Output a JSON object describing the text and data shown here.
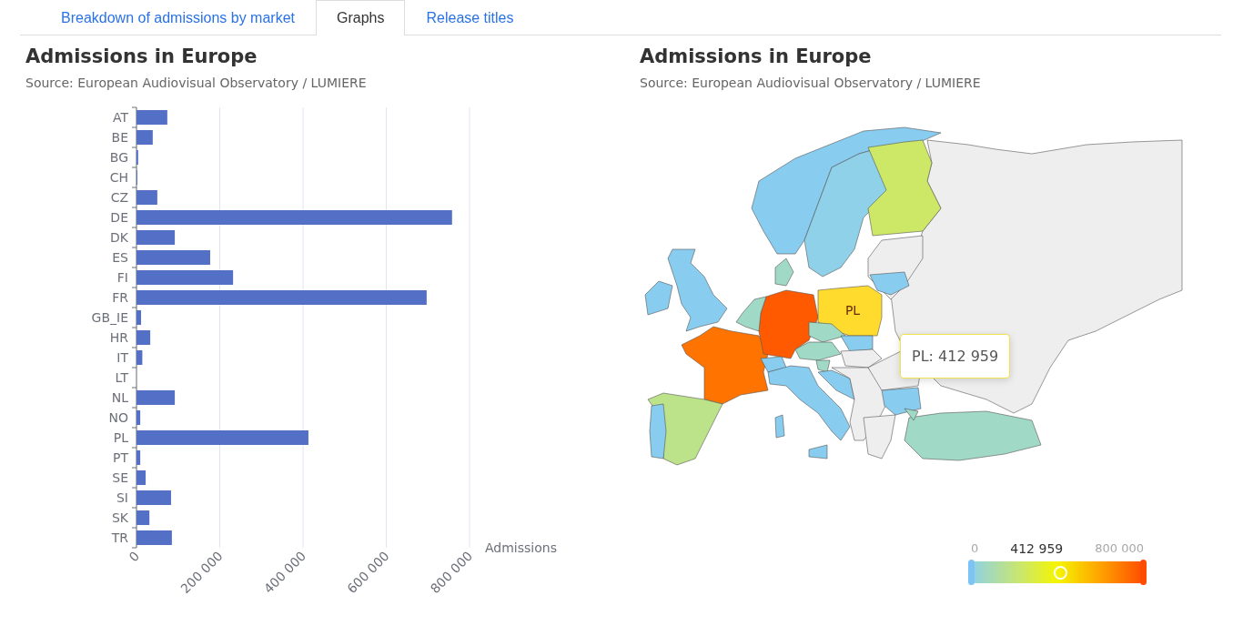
{
  "tabs": [
    {
      "label": "Breakdown of admissions by market",
      "selected": false
    },
    {
      "label": "Graphs",
      "selected": true
    },
    {
      "label": "Release titles",
      "selected": false
    }
  ],
  "bar_panel": {
    "title": "Admissions in Europe",
    "source": "Source: European Audiovisual Observatory / LUMIERE",
    "chart_data": {
      "type": "bar",
      "orientation": "horizontal",
      "xlabel": "Admissions",
      "categories": [
        "AT",
        "BE",
        "BG",
        "CH",
        "CZ",
        "DE",
        "DK",
        "ES",
        "FI",
        "FR",
        "GB_IE",
        "HR",
        "IT",
        "LT",
        "NL",
        "NO",
        "PL",
        "PT",
        "SE",
        "SI",
        "SK",
        "TR"
      ],
      "grid": true,
      "series": [
        {
          "color": "#5470c6",
          "values": [
            74000,
            39000,
            4000,
            2000,
            50000,
            758000,
            92000,
            177000,
            232000,
            697000,
            11000,
            33000,
            14000,
            0,
            92000,
            9000,
            413000,
            9000,
            22000,
            83000,
            31000,
            85000
          ]
        }
      ],
      "xlim": [
        0,
        800000
      ],
      "xticks": [
        {
          "value": 0,
          "label": "0"
        },
        {
          "value": 200000,
          "label": "200 000"
        },
        {
          "value": 400000,
          "label": "400 000"
        },
        {
          "value": 600000,
          "label": "600 000"
        },
        {
          "value": 800000,
          "label": "800 000"
        }
      ]
    }
  },
  "map_panel": {
    "title": "Admissions in Europe",
    "source": "Source: European Audiovisual Observatory / LUMIERE",
    "map_label": "PL",
    "tooltip": "PL: 412 959",
    "legend": {
      "min": "0",
      "max": "800 000",
      "reading": "412 959",
      "level": 0.516
    }
  }
}
